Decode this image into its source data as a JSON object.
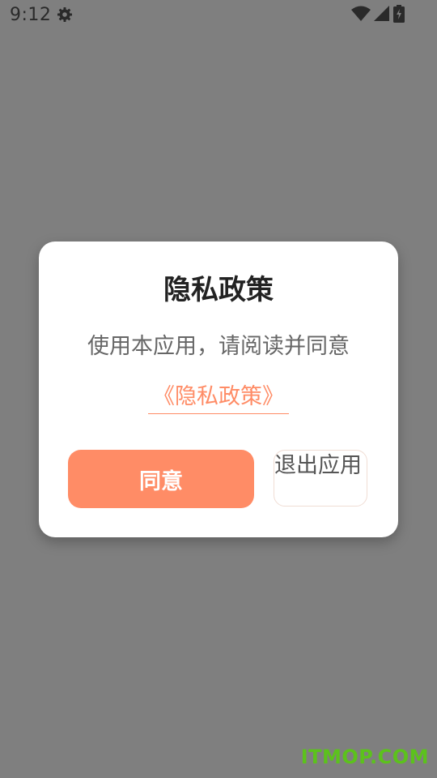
{
  "status_bar": {
    "time": "9:12",
    "icons": [
      "gear-icon",
      "wifi-icon",
      "signal-icon",
      "battery-icon"
    ]
  },
  "dialog": {
    "title": "隐私政策",
    "message": "使用本应用，请阅读并同意",
    "policy_link": "《隐私政策》",
    "agree_label": "同意",
    "exit_label": "退出应用"
  },
  "watermark": "ITMOP.COM",
  "colors": {
    "accent": "#ff8c66",
    "overlay": "#7f7f7f",
    "watermark": "#5cc21c"
  }
}
